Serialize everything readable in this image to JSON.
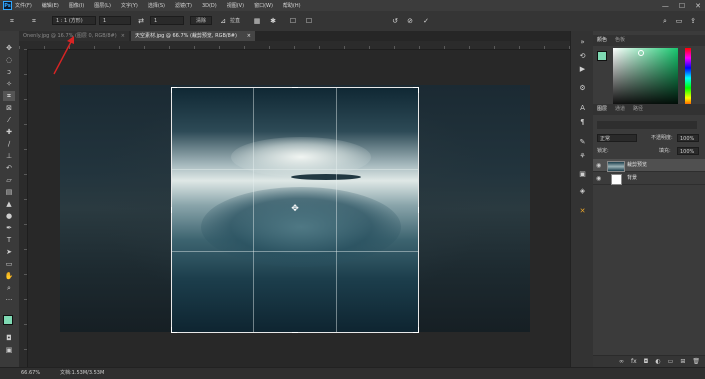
{
  "app": {
    "logo": "Ps"
  },
  "menu": [
    "文件(F)",
    "编辑(E)",
    "图像(I)",
    "图层(L)",
    "文字(Y)",
    "选择(S)",
    "滤镜(T)",
    "3D(D)",
    "视图(V)",
    "窗口(W)",
    "帮助(H)"
  ],
  "window_controls": {
    "minimize": "—",
    "maximize": "☐",
    "close": "✕"
  },
  "options": {
    "ratio_select": "1 : 1 (方形)",
    "width_value": "1",
    "height_value": "1",
    "clear_label": "清除",
    "straighten_label": "拉直",
    "delete_pixels_label": "删除裁剪的像素",
    "content_aware_label": "内容识别"
  },
  "tabs": [
    {
      "label": "Onenly.jpg @ 16.7% (图层 0, RGB/8#)",
      "close": "×"
    },
    {
      "label": "天空素材.jpg @ 66.7% (裁剪预览, RGB/8#)",
      "close": "×"
    }
  ],
  "status": {
    "zoom": "66.67%",
    "doc": "文档:1.53M/3.53M"
  },
  "color_panel": {
    "tab_color": "颜色",
    "tab_swatches": "色板"
  },
  "layers_panel": {
    "tab_layers": "图层",
    "tab_channels": "通道",
    "tab_paths": "路径",
    "blend_mode": "正常",
    "opacity_label": "不透明度:",
    "opacity_value": "100%",
    "lock_label": "锁定:",
    "fill_label": "填充:",
    "fill_value": "100%",
    "layers": [
      {
        "name": "裁剪预览"
      },
      {
        "name": "背景"
      }
    ]
  },
  "colors": {
    "foreground": "#7fd9b3",
    "background": "#ffffff",
    "annotation_arrow": "#d82424"
  },
  "icons": {
    "crop": "crop-icon",
    "rotate": "reset-icon",
    "cancel": "cancel-icon",
    "commit": "commit-icon",
    "grid": "overlay-grid-icon",
    "gear": "gear-icon",
    "swap": "swap-icon"
  }
}
